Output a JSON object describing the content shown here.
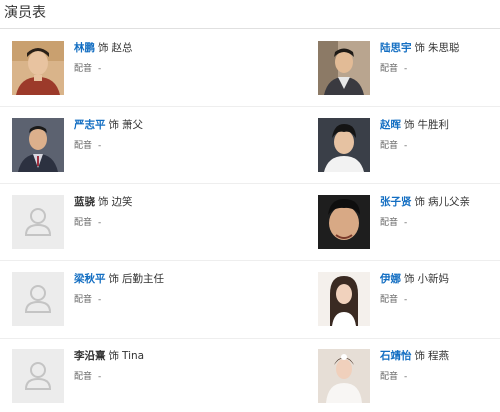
{
  "page": {
    "title": "演员表"
  },
  "common": {
    "shi": "饰",
    "voice_label": "配音",
    "voice_value": "-"
  },
  "colors": {
    "link": "#136ec2",
    "text": "#333333",
    "muted": "#666666",
    "divider": "#eeeeee"
  },
  "cast": [
    {
      "actor": "林鹏",
      "role": "赵总",
      "linked": true,
      "photo": "photo"
    },
    {
      "actor": "陆思宇",
      "role": "朱思聪",
      "linked": true,
      "photo": "photo"
    },
    {
      "actor": "严志平",
      "role": "萧父",
      "linked": true,
      "photo": "photo"
    },
    {
      "actor": "赵晖",
      "role": "牛胜利",
      "linked": true,
      "photo": "photo"
    },
    {
      "actor": "蓝骁",
      "role": "边笑",
      "linked": false,
      "photo": "placeholder"
    },
    {
      "actor": "张子贤",
      "role": "病儿父亲",
      "linked": true,
      "photo": "photo"
    },
    {
      "actor": "梁秋平",
      "role": "后勤主任",
      "linked": true,
      "photo": "placeholder"
    },
    {
      "actor": "伊娜",
      "role": "小新妈",
      "linked": true,
      "photo": "photo"
    },
    {
      "actor": "李沿熹",
      "role": "Tina",
      "linked": false,
      "photo": "placeholder"
    },
    {
      "actor": "石靖怡",
      "role": "程燕",
      "linked": true,
      "photo": "photo"
    }
  ]
}
